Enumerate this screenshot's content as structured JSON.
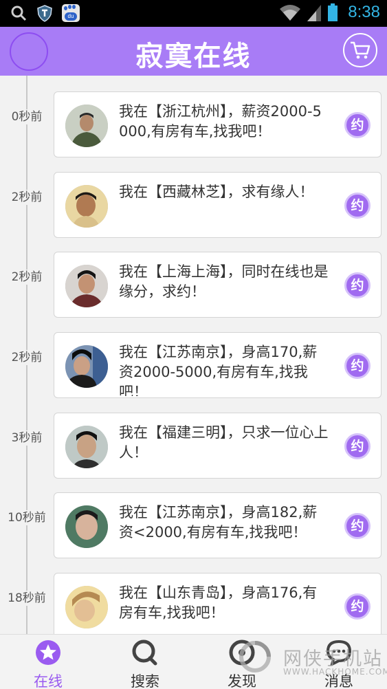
{
  "status_bar": {
    "time": "8:38",
    "icons": [
      "search-icon",
      "shield-icon",
      "baidu-paw-icon",
      "wifi-icon",
      "signal-icon",
      "battery-icon"
    ],
    "baidu_badge_text": "du"
  },
  "header": {
    "title": "寂寞在线",
    "right_icon": "cart-icon"
  },
  "feed": [
    {
      "time": "0秒前",
      "text": "我在【浙江杭州】，薪资2000-5000,有房有车,找我吧！",
      "button": "约"
    },
    {
      "time": "2秒前",
      "text": "我在【西藏林芝】，求有缘人！",
      "button": "约"
    },
    {
      "time": "2秒前",
      "text": "我在【上海上海】，同时在线也是缘分，求约！",
      "button": "约"
    },
    {
      "time": "2秒前",
      "text": "我在【江苏南京】，身高170,薪资2000-5000,有房有车,找我吧！",
      "button": "约"
    },
    {
      "time": "3秒前",
      "text": "我在【福建三明】，只求一位心上人！",
      "button": "约"
    },
    {
      "time": "10秒前",
      "text": "我在【江苏南京】，身高182,薪资<2000,有房有车,找我吧！",
      "button": "约"
    },
    {
      "time": "18秒前",
      "text": "我在【山东青岛】，身高176,有房有车,找我吧！",
      "button": "约"
    }
  ],
  "tabs": [
    {
      "label": "在线",
      "icon": "star-icon",
      "active": true
    },
    {
      "label": "搜索",
      "icon": "search-icon",
      "active": false
    },
    {
      "label": "发现",
      "icon": "discover-icon",
      "active": false
    },
    {
      "label": "消息",
      "icon": "message-icon",
      "active": false
    }
  ],
  "watermark": {
    "text": "网侠手机站",
    "sub": "WWW.HACKHOME.COM"
  },
  "colors": {
    "accent": "#a87cf6",
    "button": "#a06bf0",
    "active_tab": "#9a5bf0",
    "status_time": "#33b5e5"
  }
}
